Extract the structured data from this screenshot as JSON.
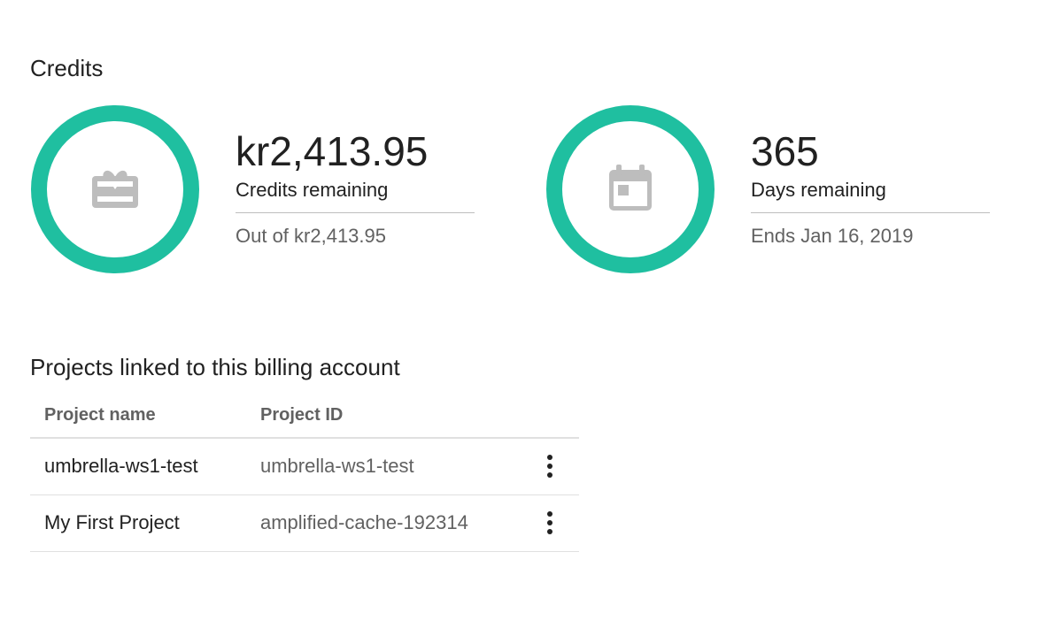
{
  "credits": {
    "title": "Credits",
    "ring_color": "#1fbfa0",
    "icon": "gift-card-icon",
    "amount": "kr2,413.95",
    "label": "Credits remaining",
    "sub": "Out of kr2,413.95"
  },
  "days": {
    "ring_color": "#1fbfa0",
    "icon": "calendar-icon",
    "amount": "365",
    "label": "Days remaining",
    "sub": "Ends Jan 16, 2019"
  },
  "projects": {
    "title": "Projects linked to this billing account",
    "columns": [
      "Project name",
      "Project ID"
    ],
    "rows": [
      {
        "name": "umbrella-ws1-test",
        "id": "umbrella-ws1-test"
      },
      {
        "name": "My First Project",
        "id": "amplified-cache-192314"
      }
    ]
  }
}
